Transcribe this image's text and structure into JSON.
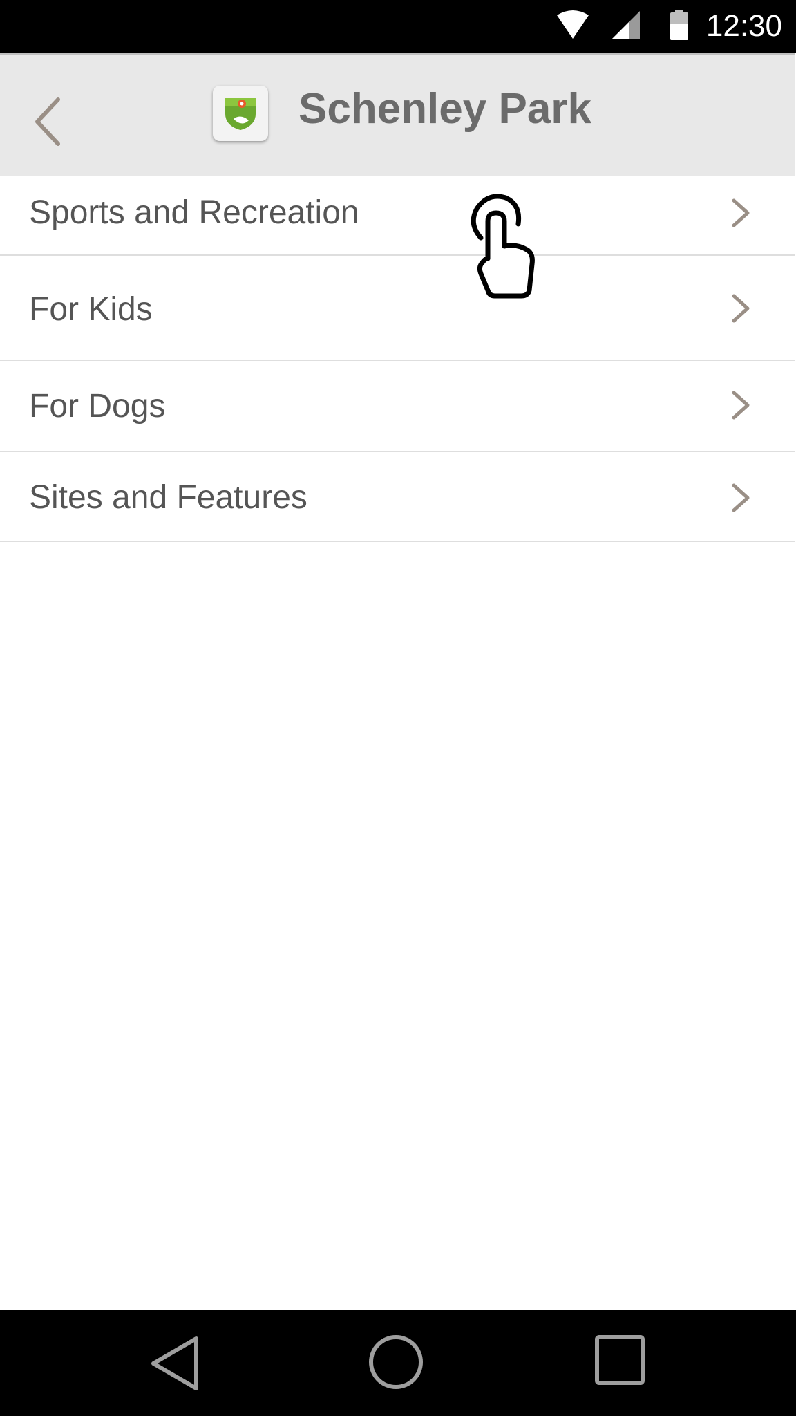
{
  "status_bar": {
    "time": "12:30",
    "icons": [
      "wifi-icon",
      "signal-icon",
      "battery-icon"
    ]
  },
  "app_bar": {
    "title": "Schenley Park",
    "back_icon": "chevron-left-icon",
    "app_icon": "park-map-icon"
  },
  "list": {
    "items": [
      {
        "label": "Sports and Recreation",
        "icon": "chevron-right-icon"
      },
      {
        "label": "For Kids",
        "icon": "chevron-right-icon"
      },
      {
        "label": "For Dogs",
        "icon": "chevron-right-icon"
      },
      {
        "label": "Sites and Features",
        "icon": "chevron-right-icon"
      }
    ]
  },
  "nav_bar": {
    "icons": [
      "nav-back-icon",
      "nav-home-icon",
      "nav-recents-icon"
    ]
  },
  "colors": {
    "status_bar_bg": "#000000",
    "app_bar_bg": "#e8e8e8",
    "title_text": "#6b6b6b",
    "list_text": "#555555",
    "chevron": "#9a8f86",
    "divider": "#dedede",
    "app_icon_green": "#8cc63f"
  }
}
